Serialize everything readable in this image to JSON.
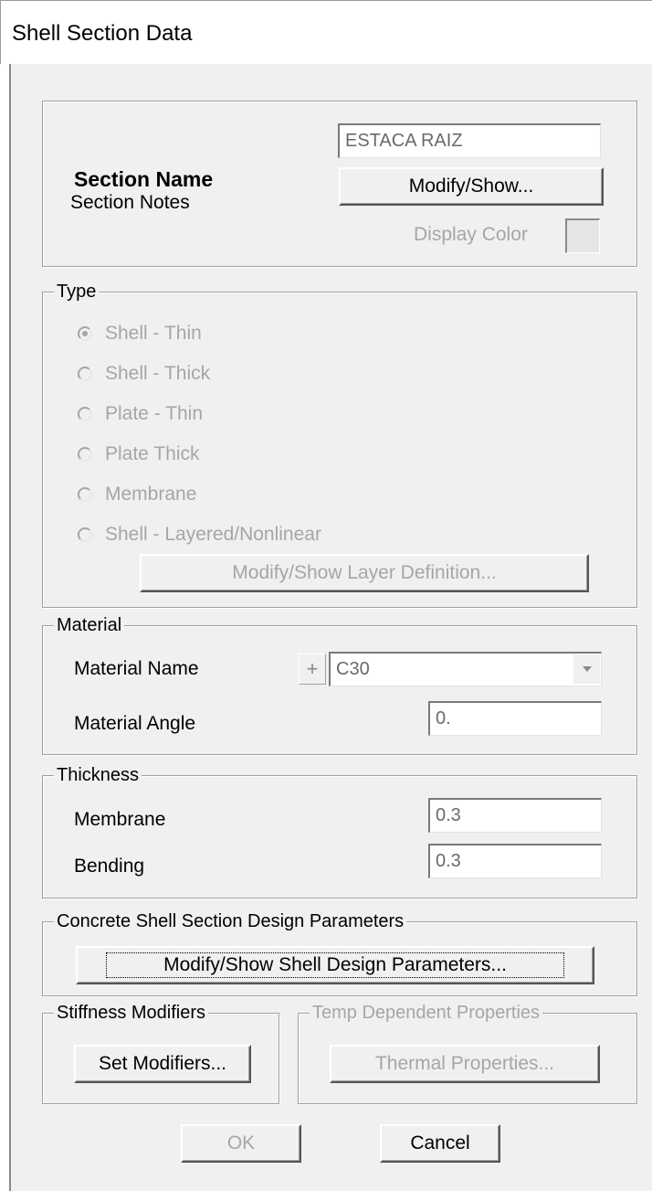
{
  "window": {
    "title": "Shell Section Data"
  },
  "section": {
    "name_label": "Section Name",
    "name_value": "ESTACA RAIZ",
    "notes_label": "Section Notes",
    "notes_button": "Modify/Show...",
    "display_color_label": "Display Color"
  },
  "type": {
    "legend": "Type",
    "options": [
      {
        "label": "Shell - Thin",
        "checked": true
      },
      {
        "label": "Shell - Thick",
        "checked": false
      },
      {
        "label": "Plate - Thin",
        "checked": false
      },
      {
        "label": "Plate Thick",
        "checked": false
      },
      {
        "label": "Membrane",
        "checked": false
      },
      {
        "label": "Shell - Layered/Nonlinear",
        "checked": false
      }
    ],
    "layer_button": "Modify/Show Layer Definition..."
  },
  "material": {
    "legend": "Material",
    "name_label": "Material Name",
    "plus_symbol": "+",
    "name_value": "C30",
    "angle_label": "Material Angle",
    "angle_value": "0."
  },
  "thickness": {
    "legend": "Thickness",
    "membrane_label": "Membrane",
    "membrane_value": "0.3",
    "bending_label": "Bending",
    "bending_value": "0.3"
  },
  "design": {
    "legend": "Concrete Shell Section Design Parameters",
    "button": "Modify/Show Shell Design Parameters..."
  },
  "stiffness": {
    "legend": "Stiffness Modifiers",
    "button": "Set Modifiers..."
  },
  "temp": {
    "legend": "Temp Dependent Properties",
    "button": "Thermal Properties..."
  },
  "footer": {
    "ok": "OK",
    "cancel": "Cancel"
  }
}
